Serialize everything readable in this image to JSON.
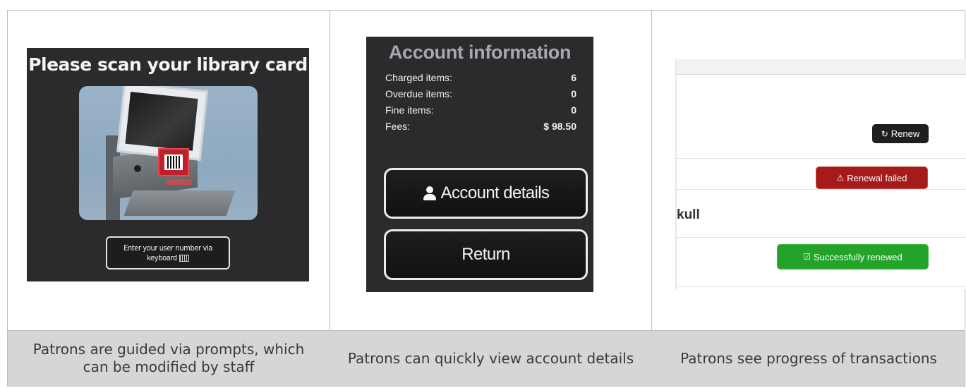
{
  "panels": [
    {
      "title": "Please scan your library card",
      "button_label_line1": "Enter your user number via",
      "button_label_line2": "keyboard",
      "caption": "Patrons are guided via prompts, which can be modified by staff"
    },
    {
      "title": "Account information",
      "rows": [
        {
          "label": "Charged items:",
          "value": "6"
        },
        {
          "label": "Overdue items:",
          "value": "0"
        },
        {
          "label": "Fine items:",
          "value": "0"
        },
        {
          "label": "Fees:",
          "value": "$ 98.50"
        }
      ],
      "account_details_label": "Account details",
      "return_label": "Return",
      "caption": "Patrons can quickly view account details"
    },
    {
      "renew_label": "Renew",
      "renewal_failed_label": "Renewal failed",
      "partial_title": "kull",
      "success_label": "Successfully renewed",
      "caption": "Patrons see progress of transactions"
    }
  ],
  "icons": {
    "renew": "refresh-icon",
    "failed": "warning-icon",
    "success": "check-square-icon",
    "user": "user-icon",
    "keyboard": "keyboard-icon"
  },
  "colors": {
    "kiosk_bg": "#2b2b2e",
    "caption_bg": "#d6d6d6",
    "renew": "#1f1f1f",
    "failed": "#a51a1a",
    "success": "#24a32a"
  }
}
